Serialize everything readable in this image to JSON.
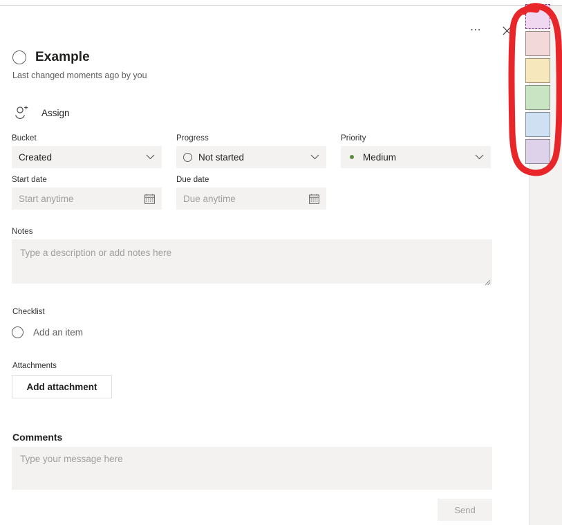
{
  "window": {
    "accent_color": "#6264a7",
    "annotation_color": "#e8262a"
  },
  "header": {
    "more_options_label": "...",
    "more_options_icon": "ellipsis-icon",
    "close_icon": "close-icon"
  },
  "task": {
    "complete_toggle_icon": "circle-checkbox-icon",
    "title": "Example",
    "subtitle": "Last changed moments ago by you"
  },
  "assign": {
    "icon": "assign-person-add-icon",
    "label": "Assign"
  },
  "fields": {
    "bucket": {
      "label": "Bucket",
      "value": "Created",
      "chevron_icon": "chevron-down-icon"
    },
    "progress": {
      "label": "Progress",
      "value": "Not started",
      "status_icon": "not-started-circle-icon",
      "chevron_icon": "chevron-down-icon"
    },
    "priority": {
      "label": "Priority",
      "value": "Medium",
      "dot_color": "#5b8c3e",
      "chevron_icon": "chevron-down-icon"
    },
    "start_date": {
      "label": "Start date",
      "value": "",
      "placeholder": "Start anytime",
      "calendar_icon": "calendar-icon"
    },
    "due_date": {
      "label": "Due date",
      "value": "",
      "placeholder": "Due anytime",
      "calendar_icon": "calendar-icon"
    }
  },
  "notes": {
    "label": "Notes",
    "value": "",
    "placeholder": "Type a description or add notes here",
    "resize_icon": "resize-grip-icon"
  },
  "checklist": {
    "label": "Checklist",
    "add_item_placeholder": "Add an item",
    "item_check_icon": "circle-checkbox-icon"
  },
  "attachments": {
    "label": "Attachments",
    "add_button_label": "Add attachment"
  },
  "comments": {
    "heading": "Comments",
    "value": "",
    "placeholder": "Type your message here",
    "send_label": "Send"
  },
  "color_picker": {
    "swatches": [
      {
        "name": "pink",
        "color": "#f0d8f0",
        "selected": true
      },
      {
        "name": "red",
        "color": "#f2d8d8",
        "selected": false
      },
      {
        "name": "yellow",
        "color": "#f7e7bd",
        "selected": false
      },
      {
        "name": "green",
        "color": "#c9e4c2",
        "selected": false
      },
      {
        "name": "blue",
        "color": "#cfe0f2",
        "selected": false
      },
      {
        "name": "purple",
        "color": "#ddd2ea",
        "selected": false
      }
    ]
  }
}
